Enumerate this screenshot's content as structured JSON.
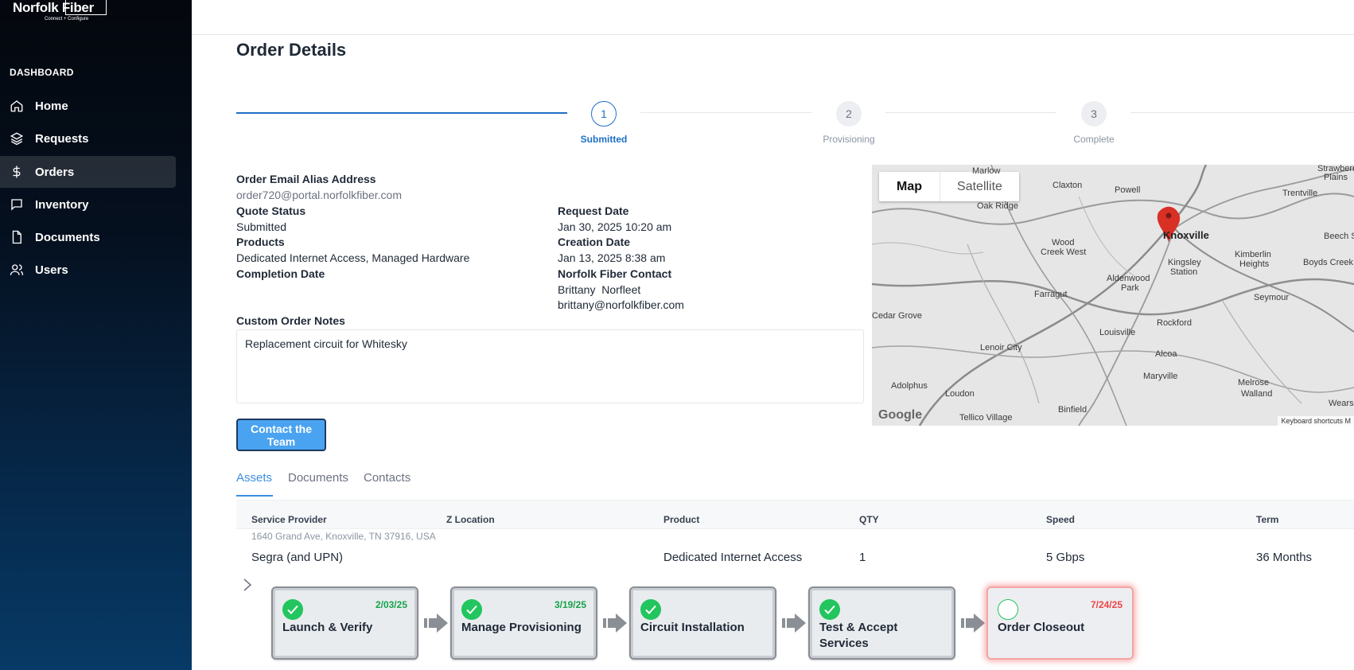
{
  "brand": {
    "name": "Norfolk Fiber",
    "tagline": "Connect + Configure"
  },
  "sidebar": {
    "section_label": "DASHBOARD",
    "items": [
      {
        "label": "Home",
        "icon": "home-icon",
        "active": false
      },
      {
        "label": "Requests",
        "icon": "layers-icon",
        "active": false
      },
      {
        "label": "Orders",
        "icon": "dollar-icon",
        "active": true
      },
      {
        "label": "Inventory",
        "icon": "chat-bubble-icon",
        "active": false
      },
      {
        "label": "Documents",
        "icon": "document-icon",
        "active": false
      },
      {
        "label": "Users",
        "icon": "users-icon",
        "active": false
      }
    ]
  },
  "page": {
    "title": "Order Details"
  },
  "stepper": {
    "steps": [
      {
        "number": "1",
        "label": "Submitted",
        "state": "active"
      },
      {
        "number": "2",
        "label": "Provisioning",
        "state": "idle"
      },
      {
        "number": "3",
        "label": "Complete",
        "state": "idle"
      }
    ]
  },
  "details": {
    "email_alias_label": "Order Email Alias Address",
    "email_alias_value": "order720@portal.norfolkfiber.com",
    "quote_status_label": "Quote Status",
    "quote_status_value": "Submitted",
    "products_label": "Products",
    "products_value": "Dedicated Internet Access, Managed Hardware",
    "completion_date_label": "Completion Date",
    "completion_date_value": "",
    "request_date_label": "Request Date",
    "request_date_value": "Jan 30, 2025 10:20 am",
    "creation_date_label": "Creation Date",
    "creation_date_value": "Jan 13, 2025 8:38 am",
    "contact_label": "Norfolk Fiber Contact",
    "contact_name": "Brittany  Norfleet",
    "contact_email": "brittany@norfolkfiber.com",
    "notes_label": "Custom Order Notes",
    "notes_value": "Replacement circuit for Whitesky",
    "contact_button": "Contact the Team"
  },
  "map": {
    "tab_map": "Map",
    "tab_satellite": "Satellite",
    "city": "Knoxville",
    "places": [
      "Marlow",
      "Claxton",
      "Powell",
      "Oak Ridge",
      "Wood",
      "Creek West",
      "Farragut",
      "Aldenwood",
      "Park",
      "Kingsley",
      "Station",
      "Kimberlin",
      "Heights",
      "Boyds Creek",
      "Beech S",
      "Seymour",
      "Louisville",
      "Rockford",
      "Alcoa",
      "Maryville",
      "Melrose",
      "Walland",
      "Lenoir City",
      "Loudon",
      "Adolphus",
      "Binfield",
      "Tellico Village",
      "Wears Valle",
      "Cedar Grove",
      "Trentville",
      "Strawberry",
      "Plains"
    ],
    "google": "Google",
    "keyboard_shortcuts": "Keyboard shortcuts",
    "map_data_clip": "M"
  },
  "tabs": [
    {
      "label": "Assets",
      "active": true
    },
    {
      "label": "Documents",
      "active": false
    },
    {
      "label": "Contacts",
      "active": false
    }
  ],
  "table": {
    "headers": [
      "Service Provider",
      "Z Location",
      "Product",
      "QTY",
      "Speed",
      "Term"
    ],
    "address": "1640 Grand Ave, Knoxville, TN 37916, USA",
    "row": [
      "Segra (and UPN)",
      "",
      "Dedicated Internet Access",
      "1",
      "5 Gbps",
      "36 Months"
    ]
  },
  "milestones": [
    {
      "title": "Launch & Verify",
      "date": "2/03/25",
      "done": true
    },
    {
      "title": "Manage Provisioning",
      "date": "3/19/25",
      "done": true
    },
    {
      "title": "Circuit Installation",
      "date": "",
      "done": true
    },
    {
      "title": "Test & Accept Services",
      "date": "",
      "done": true
    },
    {
      "title": "Order Closeout",
      "date": "7/24/25",
      "done": false
    }
  ],
  "colors": {
    "primary": "#1f6fc6",
    "button": "#4aa3f0",
    "success": "#22c55e",
    "danger": "#ef4444"
  }
}
